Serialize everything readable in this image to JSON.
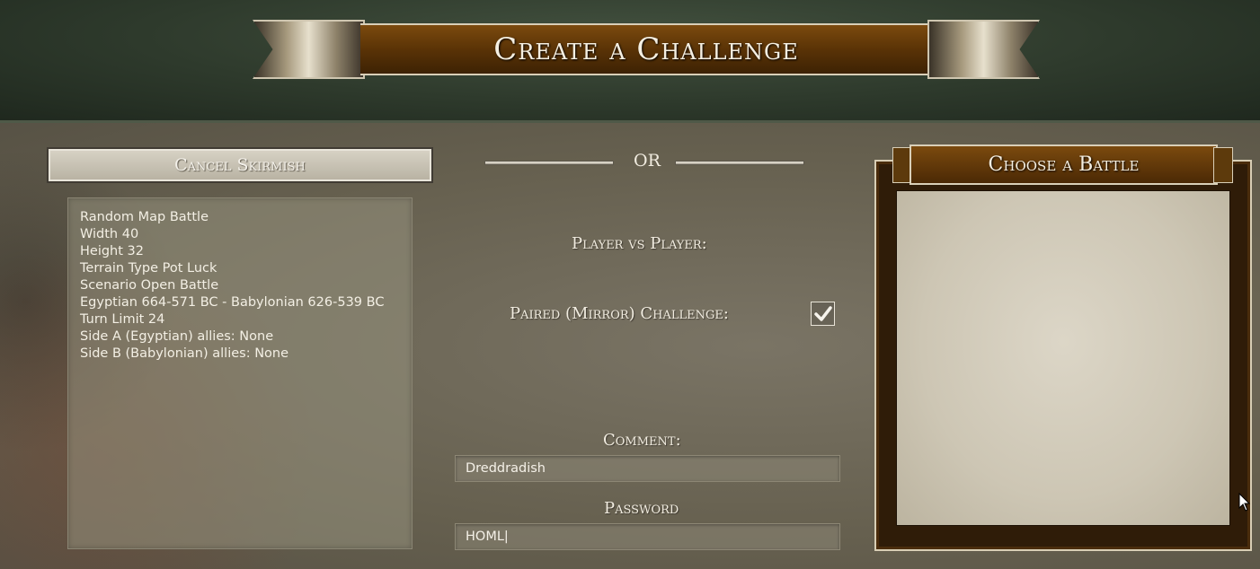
{
  "header": {
    "title": "Create a Challenge"
  },
  "left": {
    "cancel_label": "Cancel Skirmish",
    "info_lines": [
      "Random Map Battle",
      "Width 40",
      "Height 32",
      "Terrain Type Pot Luck",
      "Scenario Open Battle",
      "Egyptian 664-571 BC - Babylonian 626-539 BC",
      "Turn Limit 24",
      "Side A (Egyptian) allies: None",
      "Side B (Babylonian) allies: None"
    ]
  },
  "center": {
    "or_label": "OR",
    "pvp_label": "Player vs Player:",
    "paired_label": "Paired (Mirror) Challenge:",
    "paired_checked": true,
    "comment_label": "Comment:",
    "comment_value": "Dreddradish",
    "password_label": "Password",
    "password_value": "HOML|"
  },
  "right": {
    "choose_label": "Choose a Battle"
  },
  "colors": {
    "accent_wood": "#5a3306",
    "frame_trim": "#d9cfb8",
    "text": "#f1ece0"
  },
  "icons": {
    "check": "checkmark-icon",
    "cursor": "mouse-pointer-icon"
  }
}
